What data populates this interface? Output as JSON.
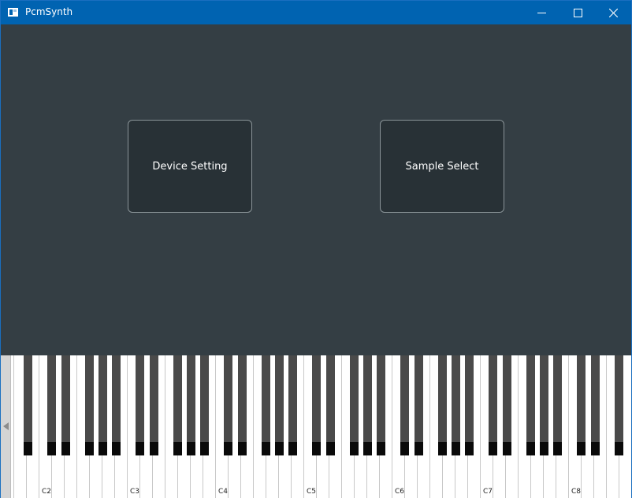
{
  "window": {
    "title": "PcmSynth",
    "icon": "app-window-icon",
    "controls": [
      "minimize-icon",
      "maximize-icon",
      "close-icon"
    ]
  },
  "main": {
    "device_setting_label": "Device Setting",
    "sample_select_label": "Sample Select"
  },
  "keyboard": {
    "scroll_icon": "scroll-left-icon",
    "octave_labels": [
      "C2",
      "C3",
      "C4",
      "C5",
      "C6",
      "C7",
      "C8"
    ]
  },
  "colors": {
    "titlebar": "#0063b1",
    "background": "#343e44",
    "button_bg": "#283136",
    "button_border": "#8a9498"
  }
}
